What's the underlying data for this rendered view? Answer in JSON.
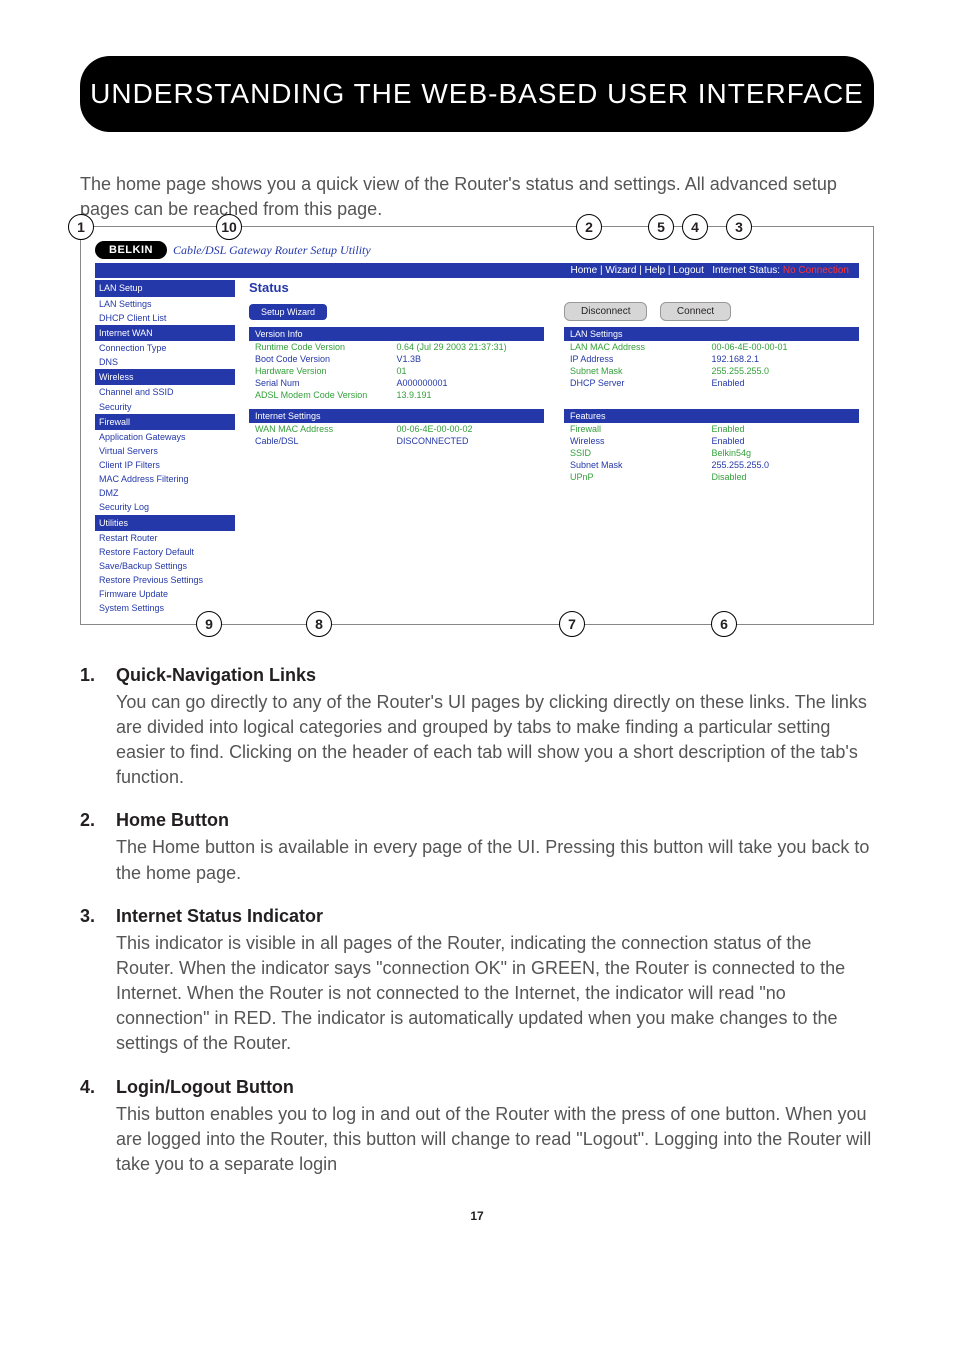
{
  "page_title": "UNDERSTANDING THE WEB-BASED USER INTERFACE",
  "intro": "The home page shows you a quick view of the Router's status and settings. All advanced setup pages can be reached from this page.",
  "callouts": {
    "c1": "1",
    "c2": "2",
    "c3": "3",
    "c4": "4",
    "c5": "5",
    "c6": "6",
    "c7": "7",
    "c8": "8",
    "c9": "9",
    "c10": "10"
  },
  "belkin": {
    "brand": "BELKIN",
    "subtitle": "Cable/DSL Gateway Router Setup Utility",
    "toplinks": "Home | Wizard | Help | Logout",
    "status_label": "Internet Status:",
    "status_value": "No Connection"
  },
  "sidebar": {
    "g1": "LAN Setup",
    "g1a": "LAN Settings",
    "g1b": "DHCP Client List",
    "g2": "Internet WAN",
    "g2a": "Connection Type",
    "g2b": "DNS",
    "g3": "Wireless",
    "g3a": "Channel and SSID",
    "g3b": "Security",
    "g4": "Firewall",
    "g4a": "Application Gateways",
    "g4b": "Virtual Servers",
    "g4c": "Client IP Filters",
    "g4d": "MAC Address Filtering",
    "g4e": "DMZ",
    "g4f": "Security Log",
    "g5": "Utilities",
    "g5a": "Restart Router",
    "g5b": "Restore Factory Default",
    "g5c": "Save/Backup Settings",
    "g5d": "Restore Previous Settings",
    "g5e": "Firmware Update",
    "g5f": "System Settings"
  },
  "main": {
    "status": "Status",
    "setup_wizard": "Setup Wizard",
    "disconnect": "Disconnect",
    "connect": "Connect",
    "version_head": "Version Info",
    "lan_head": "LAN Settings",
    "internet_head": "Internet Settings",
    "features_head": "Features",
    "rows": {
      "runtime_k": "Runtime Code Version",
      "runtime_v": "0.64 (Jul 29 2003 21:37:31)",
      "boot_k": "Boot Code Version",
      "boot_v": "V1.3B",
      "hw_k": "Hardware Version",
      "hw_v": "01",
      "serial_k": "Serial Num",
      "serial_v": "A000000001",
      "adsl_k": "ADSL Modem Code Version",
      "adsl_v": "13.9.191",
      "lanmac_k": "LAN MAC Address",
      "lanmac_v": "00-06-4E-00-00-01",
      "ip_k": "IP Address",
      "ip_v": "192.168.2.1",
      "subnet_k": "Subnet Mask",
      "subnet_v": "255.255.255.0",
      "dhcp_k": "DHCP Server",
      "dhcp_v": "Enabled",
      "wanmac_k": "WAN MAC Address",
      "wanmac_v": "00-06-4E-00-00-02",
      "cable_k": "Cable/DSL",
      "cable_v": "DISCONNECTED",
      "fw_k": "Firewall",
      "fw_v": "Enabled",
      "wl_k": "Wireless",
      "wl_v": "Enabled",
      "ssid_k": "SSID",
      "ssid_v": "Belkin54g",
      "snm_k": "Subnet Mask",
      "snm_v": "255.255.255.0",
      "upnp_k": "UPnP",
      "upnp_v": "Disabled"
    }
  },
  "sections": {
    "s1n": "1.",
    "s1h": "Quick-Navigation Links",
    "s1t": "You can go directly to any of the Router's UI pages by clicking directly on these links. The links are divided into logical categories and grouped by tabs to make finding a particular setting easier to find. Clicking on the header of each tab will show you a short description of the tab's function.",
    "s2n": "2.",
    "s2h": "Home Button",
    "s2t": "The Home button is available in every page of the UI. Pressing this button will take you back to the home page.",
    "s3n": "3.",
    "s3h": "Internet Status Indicator",
    "s3t": "This indicator is visible in all pages of the Router, indicating the connection status of the Router. When the indicator says \"connection OK\" in GREEN, the Router is connected to the Internet. When the Router is not connected to the Internet, the indicator will read \"no connection\" in RED. The indicator is automatically updated when you make changes to the settings of the Router.",
    "s4n": "4.",
    "s4h": "Login/Logout Button",
    "s4t": "This button enables you to log in and out of the Router with the press of one button. When you are logged into the Router, this button will change to read \"Logout\". Logging into the Router will take you to a separate login"
  },
  "page_number": "17"
}
